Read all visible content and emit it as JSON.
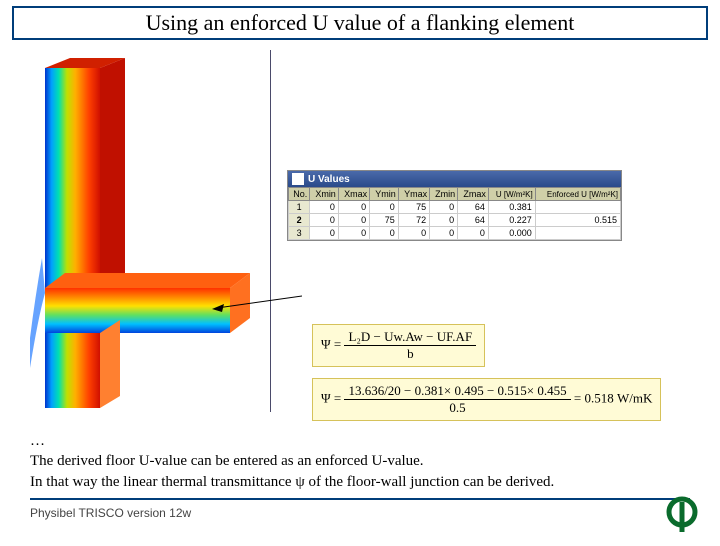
{
  "title": "Using an enforced U value of a flanking element",
  "uvalues": {
    "window_title": "U Values",
    "headers": [
      "No.",
      "Xmin",
      "Xmax",
      "Ymin",
      "Ymax",
      "Zmin",
      "Zmax",
      "U [W/m²K]",
      "Enforced U [W/m²K]"
    ],
    "rows": [
      {
        "no": "1",
        "xmin": "0",
        "xmax": "0",
        "ymin": "0",
        "ymax": "75",
        "zmin": "0",
        "zmax": "64",
        "u": "0.381",
        "eu": ""
      },
      {
        "no": "2",
        "xmin": "0",
        "xmax": "0",
        "ymin": "75",
        "ymax": "72",
        "zmin": "0",
        "zmax": "64",
        "u": "0.227",
        "eu": "0.515"
      },
      {
        "no": "3",
        "xmin": "0",
        "xmax": "0",
        "ymin": "0",
        "ymax": "0",
        "zmin": "0",
        "zmax": "0",
        "u": "0.000",
        "eu": ""
      }
    ]
  },
  "formula1": {
    "lhs": "Ψ =",
    "num": "L₂D − Uw.Aw − UF.AF",
    "den": "b"
  },
  "formula2": {
    "lhs": "Ψ =",
    "num": "13.636/20 − 0.381× 0.495 − 0.515× 0.455",
    "den": "0.5",
    "rhs": "= 0.518 W/mK"
  },
  "body": {
    "dots": "…",
    "line1": "The derived floor U-value can be entered as an enforced U-value.",
    "line2": "In that way the linear thermal transmittance ψ of the floor-wall junction can be derived."
  },
  "version": "Physibel TRISCO version 12w",
  "chart_data": {
    "type": "table",
    "title": "U Values",
    "columns": [
      "No.",
      "Xmin",
      "Xmax",
      "Ymin",
      "Ymax",
      "Zmin",
      "Zmax",
      "U [W/m²K]",
      "Enforced U [W/m²K]"
    ],
    "rows": [
      [
        1,
        0,
        0,
        0,
        75,
        0,
        64,
        0.381,
        null
      ],
      [
        2,
        0,
        0,
        75,
        72,
        0,
        64,
        0.227,
        0.515
      ],
      [
        3,
        0,
        0,
        0,
        0,
        0,
        0,
        0.0,
        null
      ]
    ]
  }
}
